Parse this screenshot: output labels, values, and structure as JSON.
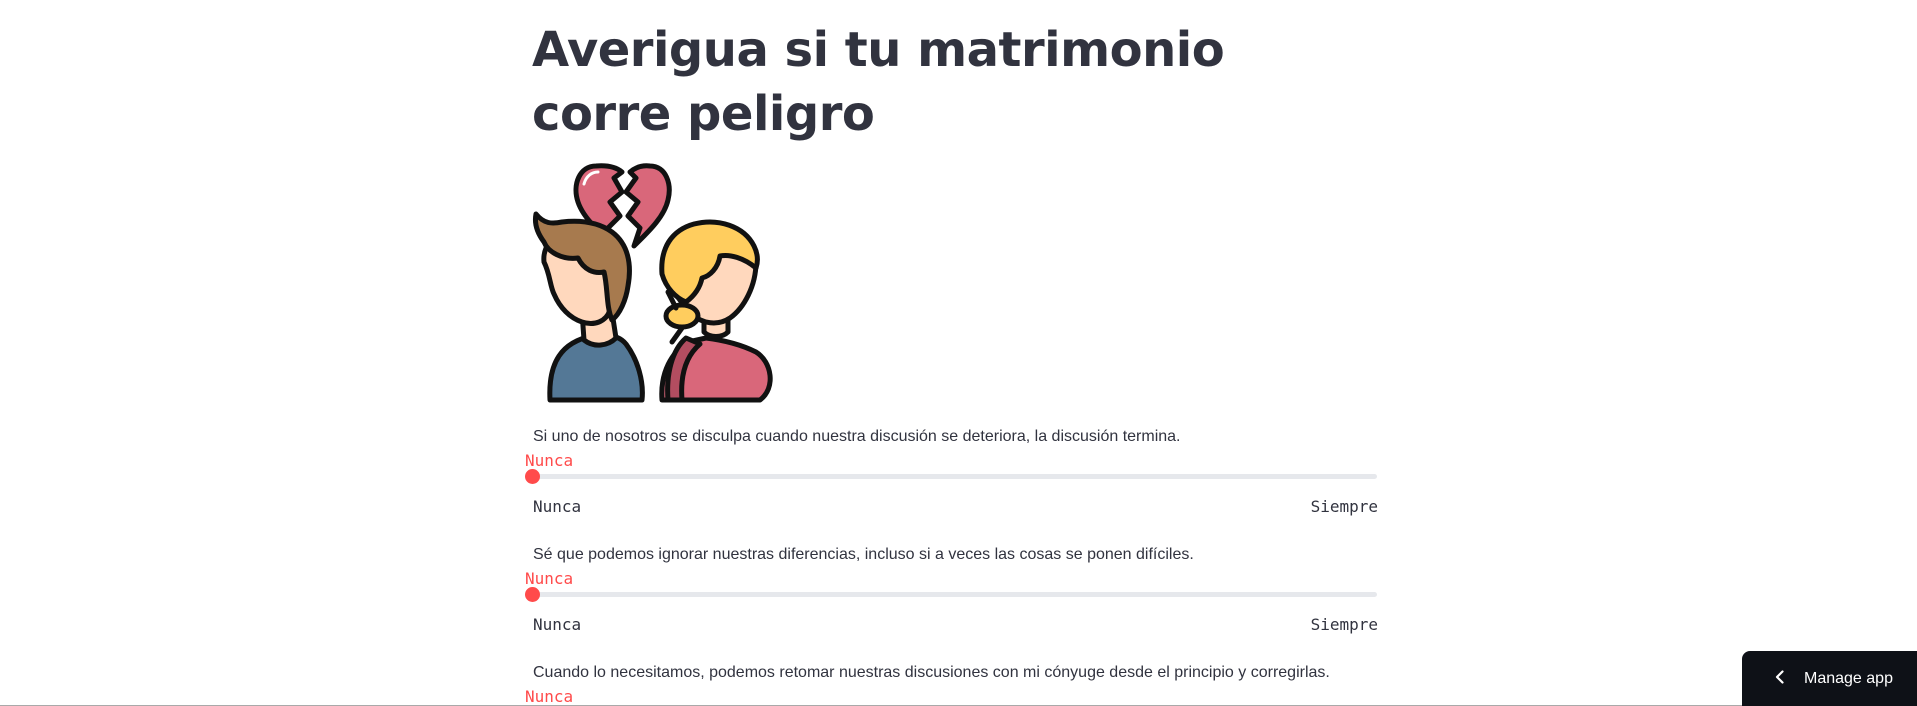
{
  "title": "Averigua si tu matrimonio corre peligro",
  "hero_image": {
    "icon": "broken-heart-couple-illustration"
  },
  "questions": [
    {
      "label": "Si uno de nosotros se disculpa cuando nuestra discusión se deteriora, la discusión termina.",
      "value": "Nunca",
      "level": 0,
      "min_label": "Nunca",
      "max_label": "Siempre"
    },
    {
      "label": "Sé que podemos ignorar nuestras diferencias, incluso si a veces las cosas se ponen difíciles.",
      "value": "Nunca",
      "level": 0,
      "min_label": "Nunca",
      "max_label": "Siempre"
    },
    {
      "label": "Cuando lo necesitamos, podemos retomar nuestras discusiones con mi cónyuge desde el principio y corregirlas.",
      "value": "Nunca",
      "level": 0
    }
  ],
  "manage_app": {
    "label": "Manage app",
    "icon": "chevron-left-icon"
  },
  "colors": {
    "accent": "#ff4b4b",
    "text": "#31333f",
    "track": "#e6e8ec",
    "manage_bg": "#0e1117"
  }
}
